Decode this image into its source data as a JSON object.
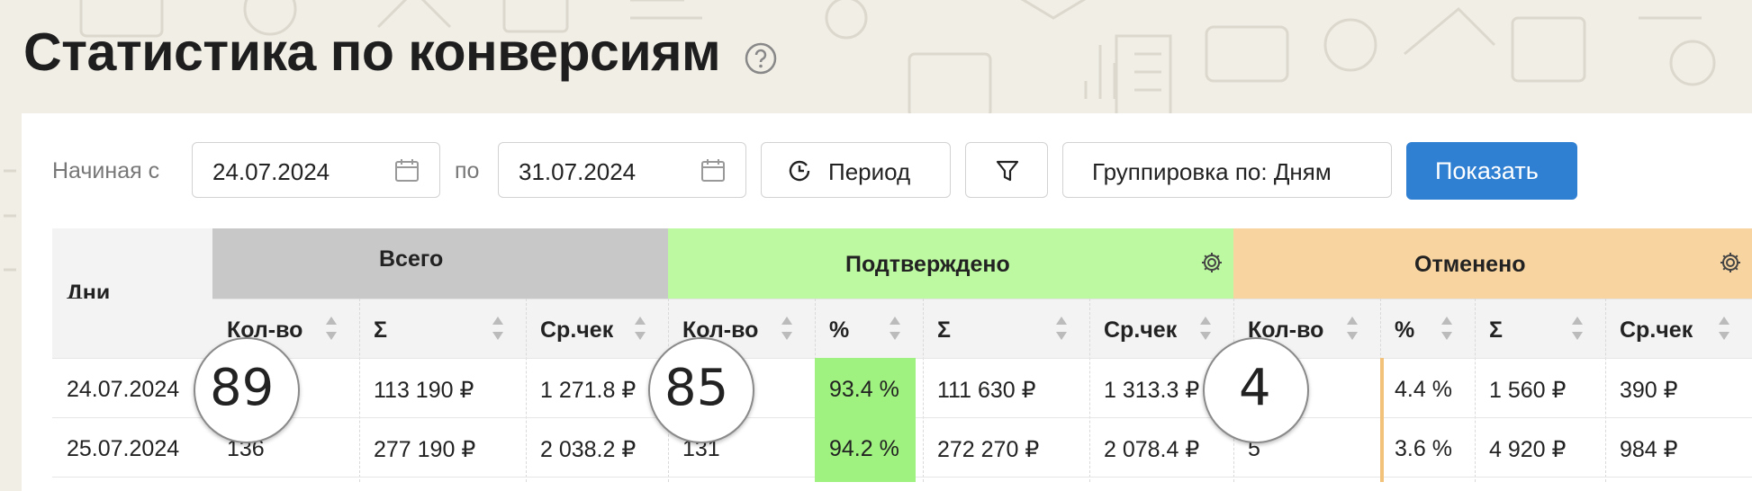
{
  "page": {
    "title": "Статистика по конверсиям",
    "help_icon": "question-circle-icon"
  },
  "filters": {
    "from_label": "Начиная с",
    "from_date": "24.07.2024",
    "to_label": "по",
    "to_date": "31.07.2024",
    "calendar_icon": "calendar-icon",
    "period_label": "Период",
    "period_icon": "clock-icon",
    "filter_icon": "funnel-icon",
    "grouping_label": "Группировка по: Дням",
    "show_label": "Показать"
  },
  "table": {
    "days_header": "Дни",
    "groups": [
      {
        "label": "Всего",
        "color": "#c8c8c8"
      },
      {
        "label": "Подтверждено",
        "color": "#bdf9a0",
        "icon": "gear-icon"
      },
      {
        "label": "Отменено",
        "color": "#f7d4a0",
        "icon": "gear-icon"
      }
    ],
    "columns": [
      "Кол-во",
      "Σ",
      "Ср.чек",
      "Кол-во",
      "%",
      "Σ",
      "Ср.чек",
      "Кол-во",
      "%",
      "Σ",
      "Ср.чек"
    ],
    "rows": [
      {
        "cells": [
          "24.07.2024",
          "",
          "113 190 ₽",
          "1 271.8 ₽",
          "",
          "93.4 %",
          "111 630 ₽",
          "1 313.3 ₽",
          "",
          "4.4 %",
          "1 560 ₽",
          "390 ₽"
        ]
      },
      {
        "cells": [
          "25.07.2024",
          "136",
          "277 190 ₽",
          "2 038.2 ₽",
          "131",
          "94.2 %",
          "272 270 ₽",
          "2 078.4 ₽",
          "5",
          "3.6 %",
          "4 920 ₽",
          "984 ₽"
        ]
      }
    ],
    "highlight_color": "#9ff27f",
    "cancel_marker_color": "#f2c27b"
  },
  "bubbles": [
    {
      "value": "89"
    },
    {
      "value": "85"
    },
    {
      "value": "4"
    }
  ]
}
